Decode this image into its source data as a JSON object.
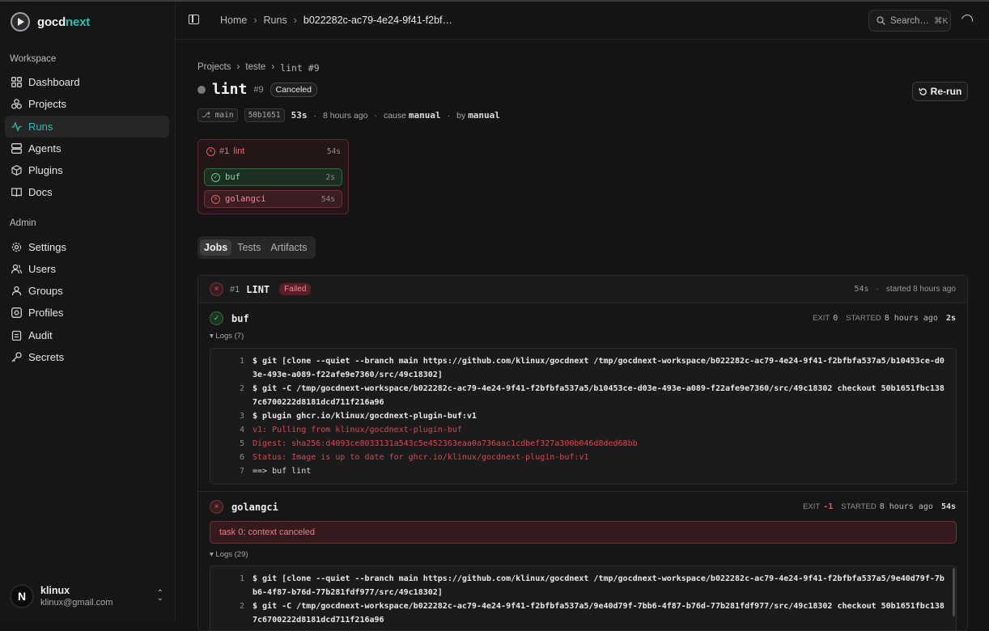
{
  "app": {
    "name_left": "gocd",
    "name_right": "next"
  },
  "sidebar": {
    "workspace_label": "Workspace",
    "workspace_items": [
      {
        "label": "Dashboard",
        "icon": "dashboard-icon"
      },
      {
        "label": "Projects",
        "icon": "projects-icon"
      },
      {
        "label": "Runs",
        "icon": "runs-icon",
        "active": true
      },
      {
        "label": "Agents",
        "icon": "agents-icon"
      },
      {
        "label": "Plugins",
        "icon": "plugins-icon"
      },
      {
        "label": "Docs",
        "icon": "docs-icon"
      }
    ],
    "admin_label": "Admin",
    "admin_items": [
      {
        "label": "Settings",
        "icon": "gear-icon"
      },
      {
        "label": "Users",
        "icon": "users-icon"
      },
      {
        "label": "Groups",
        "icon": "groups-icon"
      },
      {
        "label": "Profiles",
        "icon": "profiles-icon"
      },
      {
        "label": "Audit",
        "icon": "audit-icon"
      },
      {
        "label": "Secrets",
        "icon": "key-icon"
      }
    ],
    "user": {
      "initial": "N",
      "name": "klinux",
      "email": "klinux@gmail.com"
    }
  },
  "header": {
    "breadcrumbs": [
      "Home",
      "Runs",
      "b022282c-ac79-4e24-9f41-f2bf…"
    ],
    "search_placeholder": "Search…",
    "search_shortcut": "⌘K"
  },
  "page": {
    "crumbs": [
      "Projects",
      "teste",
      "lint #9"
    ],
    "title": "lint",
    "run_number": "#9",
    "status_badge": "Canceled",
    "rerun_label": "Re-run",
    "meta": {
      "branch": "main",
      "commit": "50b1651",
      "duration": "53s",
      "time": "8 hours ago",
      "cause_label": "cause",
      "cause": "manual",
      "by_label": "by",
      "by": "manual"
    }
  },
  "pipeline": {
    "stage": {
      "number": "#1",
      "name": "lint",
      "duration": "54s",
      "status": "failed"
    },
    "steps": [
      {
        "name": "buf",
        "duration": "2s",
        "status": "ok"
      },
      {
        "name": "golangci",
        "duration": "54s",
        "status": "failed"
      }
    ]
  },
  "tabs": [
    "Jobs",
    "Tests",
    "Artifacts"
  ],
  "job": {
    "number": "#1",
    "name": "LINT",
    "status": "Failed",
    "duration": "54s",
    "started": "started 8 hours ago",
    "steps": [
      {
        "name": "buf",
        "exit_label": "EXIT",
        "exit": "0",
        "started_label": "STARTED",
        "started": "8 hours ago",
        "duration": "2s",
        "logs_label": "▾ Logs (7)",
        "lines": [
          {
            "n": "1",
            "text": "$ git [clone --quiet --branch main https://github.com/klinux/gocdnext /tmp/gocdnext-workspace/b022282c-ac79-4e24-9f41-f2bfbfa537a5/b10453ce-d03e-493e-a089-f22afe9e7360/src/49c18302]",
            "kind": "cmd"
          },
          {
            "n": "2",
            "text": "$ git -C /tmp/gocdnext-workspace/b022282c-ac79-4e24-9f41-f2bfbfa537a5/b10453ce-d03e-493e-a089-f22afe9e7360/src/49c18302 checkout 50b1651fbc1387c6700222d8181dcd711f216a96",
            "kind": "cmd"
          },
          {
            "n": "3",
            "text": "$ plugin ghcr.io/klinux/gocdnext-plugin-buf:v1",
            "kind": "cmd"
          },
          {
            "n": "4",
            "text": "v1: Pulling from klinux/gocdnext-plugin-buf",
            "kind": "err"
          },
          {
            "n": "5",
            "text": "Digest: sha256:d4093ce8033131a543c5e452363eaa0a736aac1cdbef327a300b046d8ded68bb",
            "kind": "err"
          },
          {
            "n": "6",
            "text": "Status: Image is up to date for ghcr.io/klinux/gocdnext-plugin-buf:v1",
            "kind": "err"
          },
          {
            "n": "7",
            "text": "==> buf lint",
            "kind": "plain"
          }
        ]
      },
      {
        "name": "golangci",
        "exit_label": "EXIT",
        "exit": "-1",
        "started_label": "STARTED",
        "started": "8 hours ago",
        "duration": "54s",
        "error": "task 0: context canceled",
        "logs_label": "▾ Logs (29)",
        "lines": [
          {
            "n": "1",
            "text": "$ git [clone --quiet --branch main https://github.com/klinux/gocdnext /tmp/gocdnext-workspace/b022282c-ac79-4e24-9f41-f2bfbfa537a5/9e40d79f-7bb6-4f87-b76d-77b281fdf977/src/49c18302]",
            "kind": "cmd"
          },
          {
            "n": "2",
            "text": "$ git -C /tmp/gocdnext-workspace/b022282c-ac79-4e24-9f41-f2bfbfa537a5/9e40d79f-7bb6-4f87-b76d-77b281fdf977/src/49c18302 checkout 50b1651fbc1387c6700222d8181dcd711f216a96",
            "kind": "cmd"
          }
        ]
      }
    ]
  }
}
